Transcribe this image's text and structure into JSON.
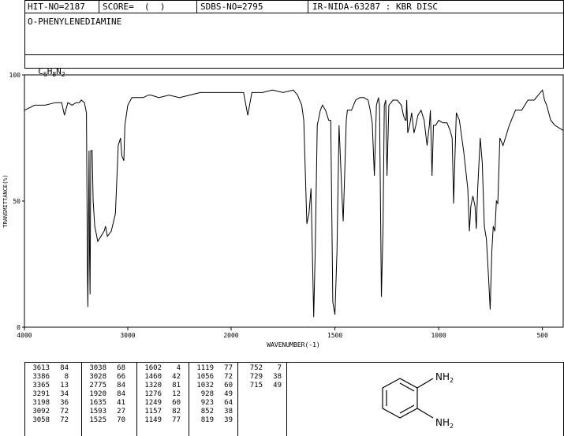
{
  "header": {
    "hit_no": "HIT-NO=2187",
    "score": "SCORE=  (  )",
    "sdbs_no": "SDBS-NO=2795",
    "method": "IR-NIDA-63287 : KBR DISC"
  },
  "compound": {
    "name": "O-PHENYLENEDIAMINE",
    "formula_parts": [
      "C",
      "6",
      "H",
      "8",
      "N",
      "2"
    ]
  },
  "chart_data": {
    "type": "line",
    "xlabel": "WAVENUMBER(-1)",
    "ylabel": "TRANSMITTANCE(%)",
    "xlim": [
      4000,
      400
    ],
    "ylim": [
      0,
      100
    ],
    "xticks": [
      4000,
      3000,
      2000,
      1500,
      1000,
      500
    ],
    "yticks": [
      0,
      50,
      100
    ],
    "grid": false,
    "x": [
      4000,
      3900,
      3800,
      3700,
      3640,
      3613,
      3580,
      3540,
      3500,
      3470,
      3450,
      3420,
      3400,
      3390,
      3386,
      3380,
      3375,
      3370,
      3365,
      3358,
      3345,
      3335,
      3320,
      3300,
      3291,
      3260,
      3230,
      3215,
      3198,
      3160,
      3120,
      3092,
      3070,
      3058,
      3038,
      3028,
      3000,
      2960,
      2900,
      2850,
      2800,
      2775,
      2700,
      2600,
      2500,
      2400,
      2300,
      2200,
      2100,
      2000,
      1940,
      1920,
      1900,
      1880,
      1850,
      1800,
      1750,
      1700,
      1680,
      1660,
      1650,
      1635,
      1625,
      1615,
      1602,
      1595,
      1585,
      1570,
      1560,
      1545,
      1530,
      1520,
      1510,
      1500,
      1490,
      1480,
      1470,
      1465,
      1460,
      1455,
      1445,
      1440,
      1420,
      1400,
      1380,
      1360,
      1340,
      1330,
      1320,
      1310,
      1300,
      1290,
      1285,
      1276,
      1268,
      1262,
      1255,
      1249,
      1240,
      1220,
      1200,
      1180,
      1170,
      1160,
      1157,
      1154,
      1149,
      1140,
      1130,
      1119,
      1110,
      1100,
      1085,
      1070,
      1056,
      1045,
      1040,
      1032,
      1025,
      1015,
      1000,
      980,
      960,
      945,
      935,
      928,
      923,
      915,
      900,
      880,
      860,
      852,
      845,
      835,
      825,
      819,
      812,
      800,
      790,
      780,
      770,
      760,
      752,
      744,
      737,
      729,
      722,
      715,
      705,
      690,
      660,
      630,
      600,
      570,
      540,
      520,
      500,
      490,
      480,
      470,
      460,
      440,
      420,
      400
    ],
    "y": [
      86,
      88,
      88,
      89,
      89,
      84,
      89,
      88,
      89,
      89,
      90,
      89,
      85,
      20,
      8,
      40,
      70,
      30,
      13,
      70,
      70,
      50,
      40,
      36,
      34,
      36,
      38,
      40,
      36,
      38,
      45,
      72,
      75,
      68,
      66,
      80,
      88,
      91,
      91,
      91,
      92,
      92,
      91,
      92,
      91,
      92,
      93,
      93,
      93,
      93,
      93,
      84,
      93,
      93,
      93,
      94,
      93,
      94,
      92,
      88,
      82,
      41,
      45,
      55,
      4,
      30,
      80,
      86,
      88,
      86,
      82,
      82,
      10,
      5,
      30,
      80,
      60,
      50,
      42,
      55,
      82,
      86,
      86,
      90,
      91,
      91,
      90,
      86,
      81,
      60,
      88,
      91,
      88,
      12,
      40,
      88,
      90,
      60,
      88,
      90,
      90,
      88,
      84,
      82,
      82,
      90,
      77,
      80,
      85,
      77,
      80,
      84,
      86,
      82,
      72,
      80,
      86,
      60,
      80,
      80,
      82,
      81,
      81,
      78,
      75,
      49,
      64,
      85,
      82,
      70,
      55,
      38,
      48,
      52,
      48,
      39,
      55,
      75,
      65,
      40,
      35,
      20,
      7,
      30,
      40,
      38,
      50,
      49,
      75,
      72,
      80,
      86,
      86,
      90,
      90,
      92,
      94,
      90,
      88,
      85,
      82,
      80,
      79,
      78
    ]
  },
  "peak_table": [
    [
      [
        "3613",
        "84"
      ],
      [
        "3386",
        "8"
      ],
      [
        "3365",
        "13"
      ],
      [
        "3291",
        "34"
      ],
      [
        "3198",
        "36"
      ],
      [
        "3092",
        "72"
      ],
      [
        "3058",
        "72"
      ]
    ],
    [
      [
        "3038",
        "68"
      ],
      [
        "3028",
        "66"
      ],
      [
        "2775",
        "84"
      ],
      [
        "1920",
        "84"
      ],
      [
        "1635",
        "41"
      ],
      [
        "1593",
        "27"
      ],
      [
        "1525",
        "70"
      ]
    ],
    [
      [
        "1602",
        "4"
      ],
      [
        "1460",
        "42"
      ],
      [
        "1320",
        "81"
      ],
      [
        "1276",
        "12"
      ],
      [
        "1249",
        "60"
      ],
      [
        "1157",
        "82"
      ],
      [
        "1149",
        "77"
      ]
    ],
    [
      [
        "1119",
        "77"
      ],
      [
        "1056",
        "72"
      ],
      [
        "1032",
        "60"
      ],
      [
        "928",
        "49"
      ],
      [
        "923",
        "64"
      ],
      [
        "852",
        "38"
      ],
      [
        "819",
        "39"
      ]
    ],
    [
      [
        "752",
        "7"
      ],
      [
        "729",
        "38"
      ],
      [
        "715",
        "49"
      ]
    ]
  ],
  "structure": {
    "nh2_top": "NH2",
    "nh2_bottom": "NH2"
  }
}
